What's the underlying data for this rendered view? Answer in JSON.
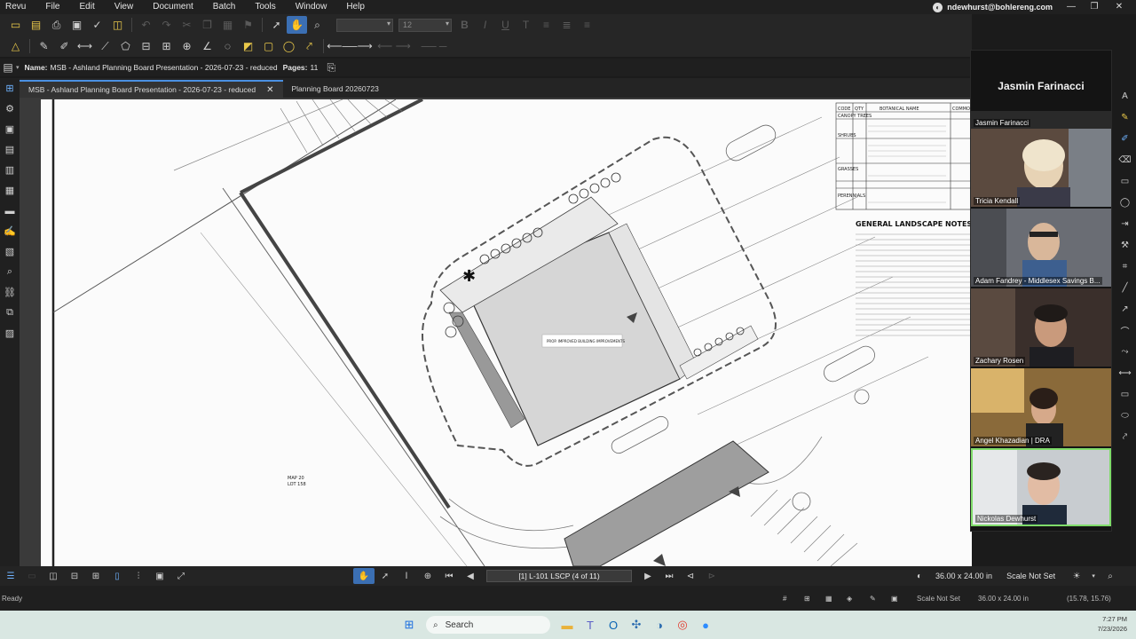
{
  "menu": {
    "items": [
      "Revu",
      "File",
      "Edit",
      "View",
      "Document",
      "Batch",
      "Tools",
      "Window",
      "Help"
    ],
    "account": "ndewhurst@bohlereng.com",
    "window_controls": [
      "—",
      "❐",
      "✕"
    ]
  },
  "toolbar": {
    "font_value": "",
    "size_value": "12"
  },
  "properties": {
    "name_label": "Name:",
    "name_value": "MSB - Ashland Planning Board Presentation - 2026-07-23 - reduced",
    "pages_label": "Pages:",
    "pages_value": "11"
  },
  "tabs": [
    {
      "label": "MSB - Ashland Planning Board Presentation - 2026-07-23 - reduced",
      "active": true
    },
    {
      "label": "Planning Board 20260723",
      "active": false
    }
  ],
  "drawing": {
    "title": "GENERAL LANDSCAPE NOTES",
    "schedule_headers": [
      "CODE",
      "QTY",
      "BOTANICAL NAME",
      "COMMO"
    ],
    "schedule_sections": [
      "CANOPY TREES",
      "SHRUBS",
      "GRASSES",
      "PERENNIALS"
    ],
    "building_label": "PROP. IMPROVED BUILDING IMPROVEMENTS",
    "lot_label_1": "MAP 20",
    "lot_label_2": "LOT 158"
  },
  "navigation": {
    "page_indicator": "[1] L-101 LSCP (4 of 11)",
    "dimensions": "36.00 x 24.00 in",
    "scale": "Scale Not Set"
  },
  "status": {
    "ready": "Ready",
    "scale": "Scale Not Set",
    "dimensions": "36.00 x 24.00 in",
    "coords": "(15.78, 15.76)"
  },
  "meeting": {
    "host_name": "Jasmin Farinacci",
    "participants": [
      {
        "name": "Jasmin Farinacci",
        "bg": "#2a2a2a"
      },
      {
        "name": "Tricia Kendall",
        "bg": "#5b4a3f"
      },
      {
        "name": "Adam Fandrey - Middlesex Savings B...",
        "bg": "#6a6d74"
      },
      {
        "name": "Zachary Rosen",
        "bg": "#3a2f2b"
      },
      {
        "name": "Angel Khazadian | DRA",
        "bg": "#8a6a3a"
      },
      {
        "name": "Nickolas Dewhurst",
        "bg": "#c8ccd0"
      }
    ]
  },
  "taskbar": {
    "search_label": "Search",
    "time": "7:27 PM",
    "date": "7/23/2026"
  }
}
